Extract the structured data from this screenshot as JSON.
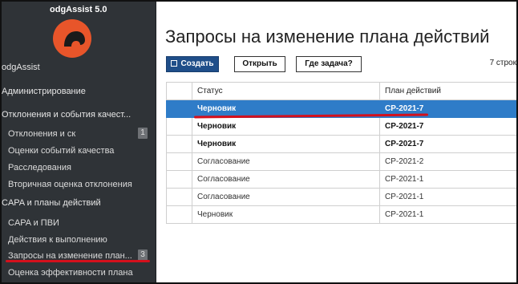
{
  "sidebar": {
    "brand": "odgAssist 5.0",
    "items": [
      {
        "label": "odgAssist"
      },
      {
        "label": "Администрирование"
      },
      {
        "label": "Отклонения и события качест..."
      },
      {
        "label": "Отклонения и ск",
        "badge": "1"
      },
      {
        "label": "Оценки событий качества"
      },
      {
        "label": "Расследования"
      },
      {
        "label": "Вторичная оценка отклонения"
      },
      {
        "label": "CAPA и планы действий"
      },
      {
        "label": "CAPA и ПВИ"
      },
      {
        "label": "Действия к выполнению"
      },
      {
        "label": "Запросы на изменение план...",
        "badge": "3"
      },
      {
        "label": "Оценка эффективности плана"
      }
    ]
  },
  "main": {
    "title": "Запросы на изменение плана действий",
    "buttons": {
      "create": "Создать",
      "open": "Открыть",
      "where_task": "Где задача?"
    },
    "record_count": "7 строк"
  },
  "table": {
    "headers": {
      "status": "Статус",
      "plan": "План действий"
    },
    "rows": [
      {
        "status": "Черновик",
        "plan": "CP-2021-7"
      },
      {
        "status": "Черновик",
        "plan": "CP-2021-7"
      },
      {
        "status": "Черновик",
        "plan": "CP-2021-7"
      },
      {
        "status": "Согласование",
        "plan": "CP-2021-2"
      },
      {
        "status": "Согласование",
        "plan": "CP-2021-1"
      },
      {
        "status": "Согласование",
        "plan": "CP-2021-1"
      },
      {
        "status": "Черновик",
        "plan": "CP-2021-1"
      }
    ]
  },
  "colors": {
    "accent": "#2f7cc8",
    "primary_button": "#1f4e89",
    "logo": "#e8552a",
    "highlight_underline": "#d4101c",
    "sidebar": "#2f3337"
  }
}
